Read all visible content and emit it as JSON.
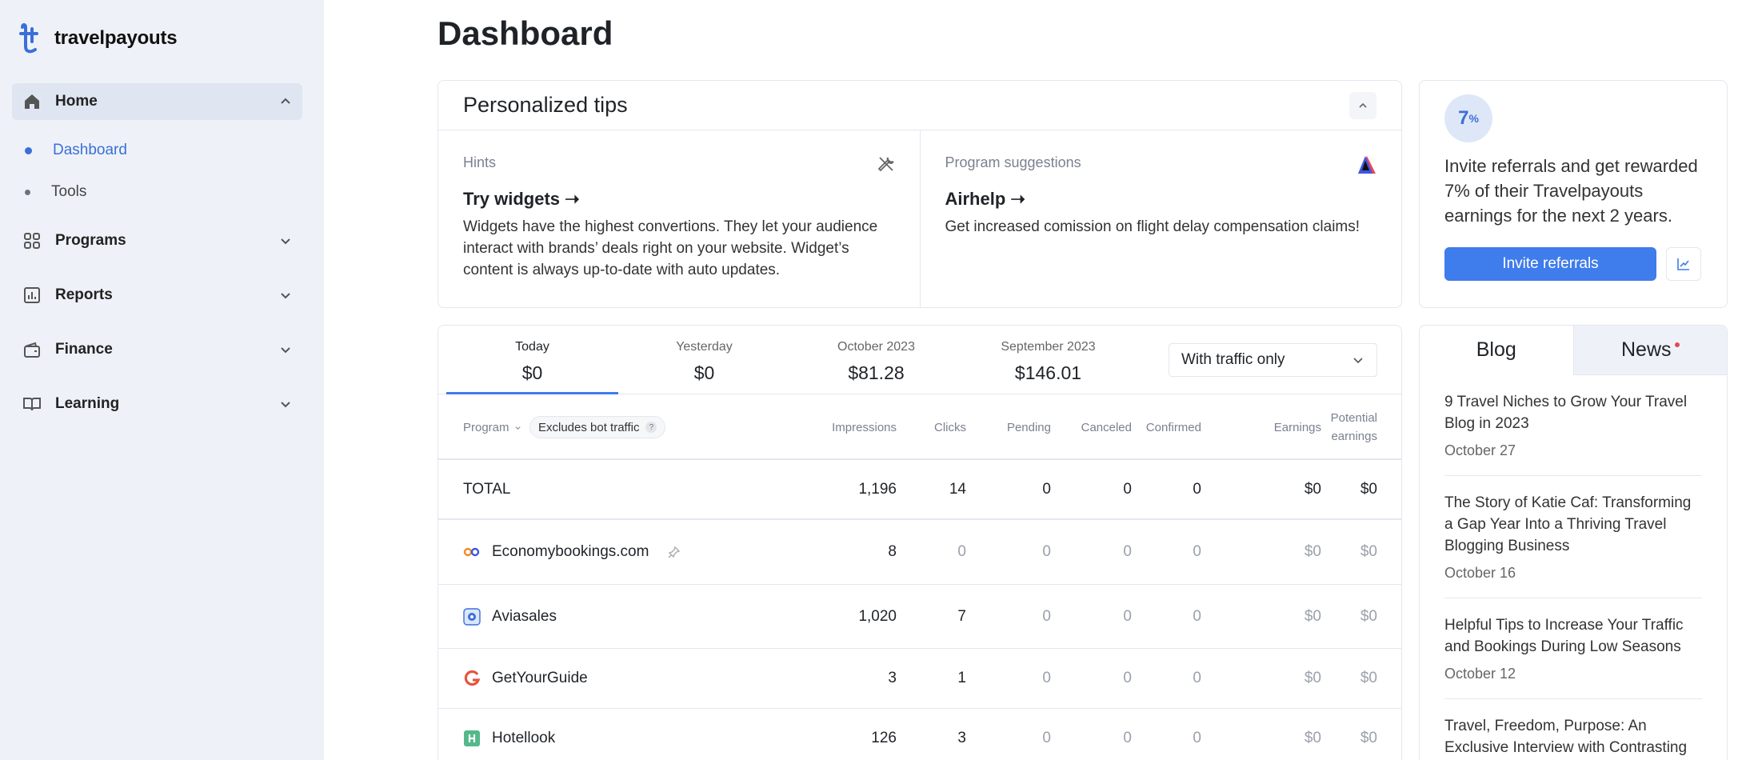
{
  "brand": {
    "name": "travelpayouts"
  },
  "sidebar": {
    "items": [
      {
        "label": "Home",
        "icon": "home-icon"
      },
      {
        "label": "Programs",
        "icon": "grid-icon"
      },
      {
        "label": "Reports",
        "icon": "chart-icon"
      },
      {
        "label": "Finance",
        "icon": "wallet-icon"
      },
      {
        "label": "Learning",
        "icon": "book-icon"
      }
    ],
    "home_sub": [
      {
        "label": "Dashboard"
      },
      {
        "label": "Tools"
      }
    ]
  },
  "page": {
    "title": "Dashboard"
  },
  "tips": {
    "title": "Personalized tips",
    "hints": {
      "category": "Hints",
      "heading": "Try widgets ➝",
      "description": "Widgets have the highest convertions. They let your audience interact with brands’ deals right on your website. Widget’s content is always up-to-date with auto updates."
    },
    "suggestions": {
      "category": "Program suggestions",
      "heading": "Airhelp ➝",
      "description": "Get increased comission on flight delay compensation claims!"
    }
  },
  "referral": {
    "badge_number": "7",
    "badge_symbol": "%",
    "text": "Invite referrals and get rewarded 7% of their Travelpayouts earnings for the next 2 years.",
    "button": "Invite referrals"
  },
  "stats": {
    "periods": [
      {
        "label": "Today",
        "value": "$0"
      },
      {
        "label": "Yesterday",
        "value": "$0"
      },
      {
        "label": "October 2023",
        "value": "$81.28"
      },
      {
        "label": "September 2023",
        "value": "$146.01"
      }
    ],
    "traffic_filter": "With traffic only",
    "headers": {
      "program": "Program",
      "bot_chip": "Excludes bot traffic",
      "impressions": "Impressions",
      "clicks": "Clicks",
      "pending": "Pending",
      "canceled": "Canceled",
      "confirmed": "Confirmed",
      "earnings": "Earnings",
      "potential": "Potential earnings"
    },
    "total": {
      "name": "TOTAL",
      "impressions": "1,196",
      "clicks": "14",
      "pending": "0",
      "canceled": "0",
      "confirmed": "0",
      "earnings": "$0",
      "potential": "$0"
    },
    "rows": [
      {
        "name": "Economybookings.com",
        "icon": "economybookings-logo",
        "impressions": "8",
        "clicks": "0",
        "pending": "0",
        "canceled": "0",
        "confirmed": "0",
        "earnings": "$0",
        "potential": "$0"
      },
      {
        "name": "Aviasales",
        "icon": "aviasales-logo",
        "impressions": "1,020",
        "clicks": "7",
        "pending": "0",
        "canceled": "0",
        "confirmed": "0",
        "earnings": "$0",
        "potential": "$0"
      },
      {
        "name": "GetYourGuide",
        "icon": "getyourguide-logo",
        "impressions": "3",
        "clicks": "1",
        "pending": "0",
        "canceled": "0",
        "confirmed": "0",
        "earnings": "$0",
        "potential": "$0"
      },
      {
        "name": "Hotellook",
        "icon": "hotellook-logo",
        "impressions": "126",
        "clicks": "3",
        "pending": "0",
        "canceled": "0",
        "confirmed": "0",
        "earnings": "$0",
        "potential": "$0"
      }
    ]
  },
  "blog": {
    "tabs": [
      "Blog",
      "News"
    ],
    "posts": [
      {
        "title": "9 Travel Niches to Grow Your Travel Blog in 2023",
        "date": "October 27"
      },
      {
        "title": "The Story of Katie Caf: Transforming a Gap Year Into a Thriving Travel Blogging Business",
        "date": "October 16"
      },
      {
        "title": "Helpful Tips to Increase Your Traffic and Bookings During Low Seasons",
        "date": "October 12"
      },
      {
        "title": "Travel, Freedom, Purpose: An Exclusive Interview with Contrasting",
        "date": ""
      }
    ]
  },
  "colors": {
    "accent": "#3f7cec",
    "sidebar_bg": "#eef2f8",
    "news_dot": "#e5484d"
  }
}
